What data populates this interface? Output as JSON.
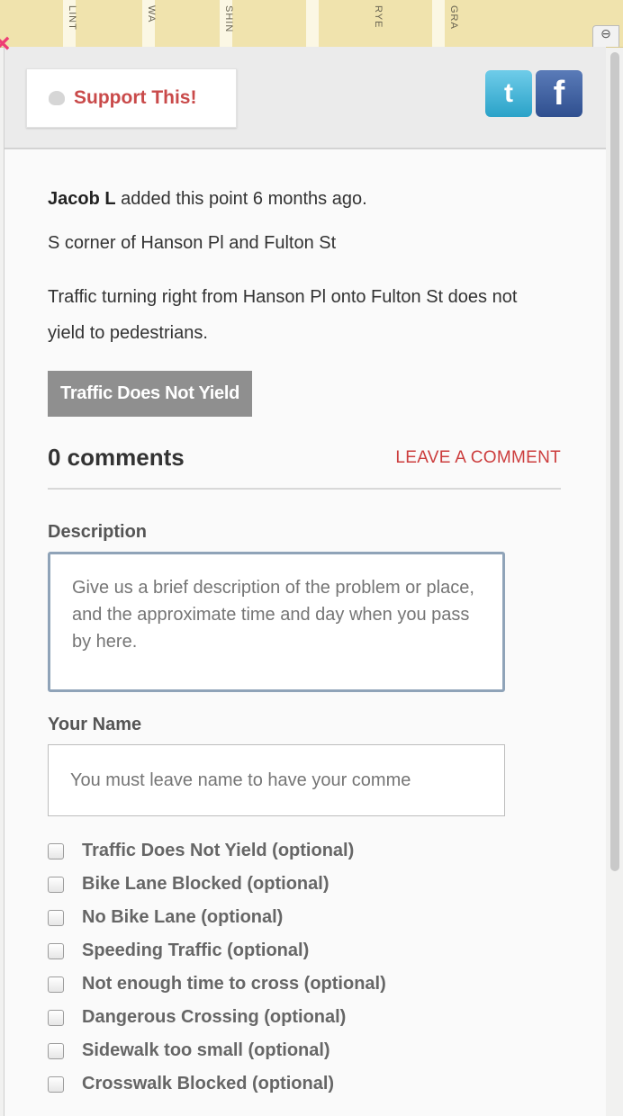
{
  "map": {
    "street_labels": [
      "LINT",
      "WA",
      "SHIN",
      "RYE",
      "GRA"
    ],
    "corner_icon": "⊖"
  },
  "close_icon_glyph": "×",
  "header": {
    "support_label": "Support This!",
    "twitter_glyph": "t",
    "facebook_glyph": "f"
  },
  "point": {
    "author": "Jacob L",
    "added_text": "added this point 6 months ago.",
    "location": "S corner of Hanson Pl and Fulton St",
    "description": "Traffic turning right from Hanson Pl onto Fulton St does not yield to pedestrians.",
    "tag": "Traffic Does Not Yield"
  },
  "comments": {
    "count_label": "0 comments",
    "leave_link": "LEAVE A COMMENT"
  },
  "form": {
    "description_label": "Description",
    "description_placeholder": "Give us a brief description of the problem or place, and the approximate time and day when you pass by here.",
    "name_label": "Your Name",
    "name_placeholder": "You must leave name to have your comme",
    "checkboxes": [
      "Traffic Does Not Yield (optional)",
      "Bike Lane Blocked (optional)",
      "No Bike Lane (optional)",
      "Speeding Traffic (optional)",
      "Not enough time to cross (optional)",
      "Dangerous Crossing (optional)",
      "Sidewalk too small (optional)",
      "Crosswalk Blocked (optional)"
    ]
  },
  "colors": {
    "accent_red": "#c94a4a",
    "close_pink": "#ee3d75",
    "tag_gray": "#8f8f8f",
    "twitter": "#2aa2c8",
    "facebook": "#2f4f8f"
  }
}
